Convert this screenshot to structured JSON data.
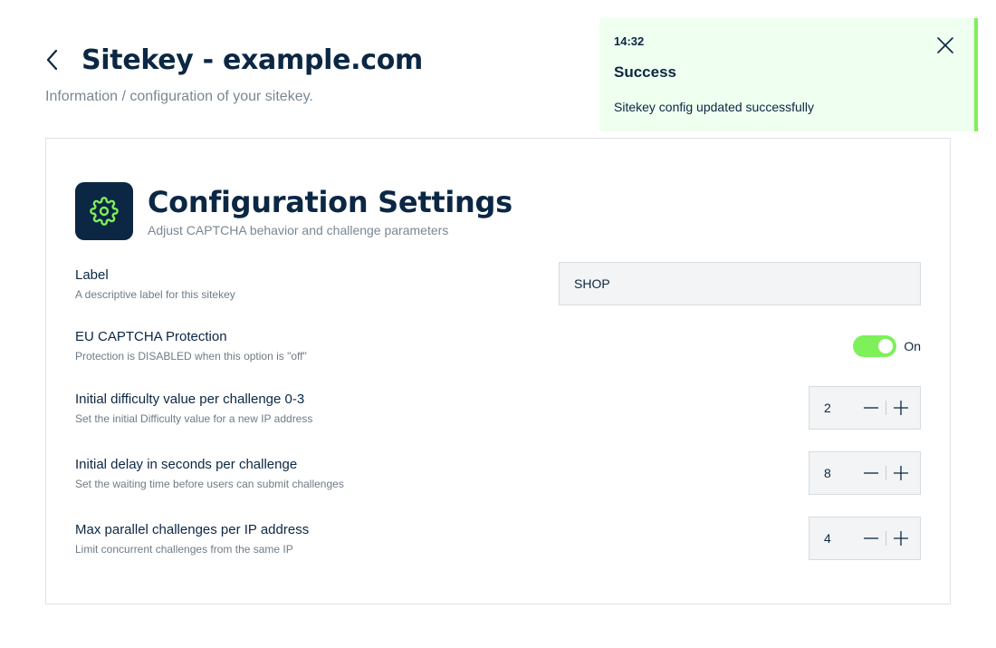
{
  "header": {
    "title": "Sitekey - example.com",
    "subtitle": "Information / configuration of your sitekey.",
    "back_icon": "chevron-left-icon"
  },
  "toast": {
    "time": "14:32",
    "title": "Success",
    "message": "Sitekey config updated successfully",
    "accent_color": "#7ef05a",
    "background": "#effff0",
    "close_icon": "close-icon"
  },
  "card": {
    "title": "Configuration Settings",
    "subtitle": "Adjust CAPTCHA behavior and challenge parameters",
    "icon": "gear-icon",
    "icon_bg": "#0b2743",
    "icon_color": "#7ef05a"
  },
  "settings": {
    "label": {
      "label": "Label",
      "description": "A descriptive label for this sitekey",
      "value": "SHOP"
    },
    "protection": {
      "label": "EU CAPTCHA Protection",
      "description": "Protection is DISABLED when this option is \"off\"",
      "state": "On",
      "enabled": true
    },
    "difficulty": {
      "label": "Initial difficulty value per challenge 0-3",
      "description": "Set the initial Difficulty value for a new IP address",
      "value": "2"
    },
    "delay": {
      "label": "Initial delay in seconds per challenge",
      "description": "Set the waiting time before users can submit challenges",
      "value": "8"
    },
    "parallel": {
      "label": "Max parallel challenges per IP address",
      "description": "Limit concurrent challenges from the same IP",
      "value": "4"
    }
  },
  "colors": {
    "primary": "#0b2743",
    "accent": "#7ef05a",
    "muted_text": "#7a8792"
  }
}
